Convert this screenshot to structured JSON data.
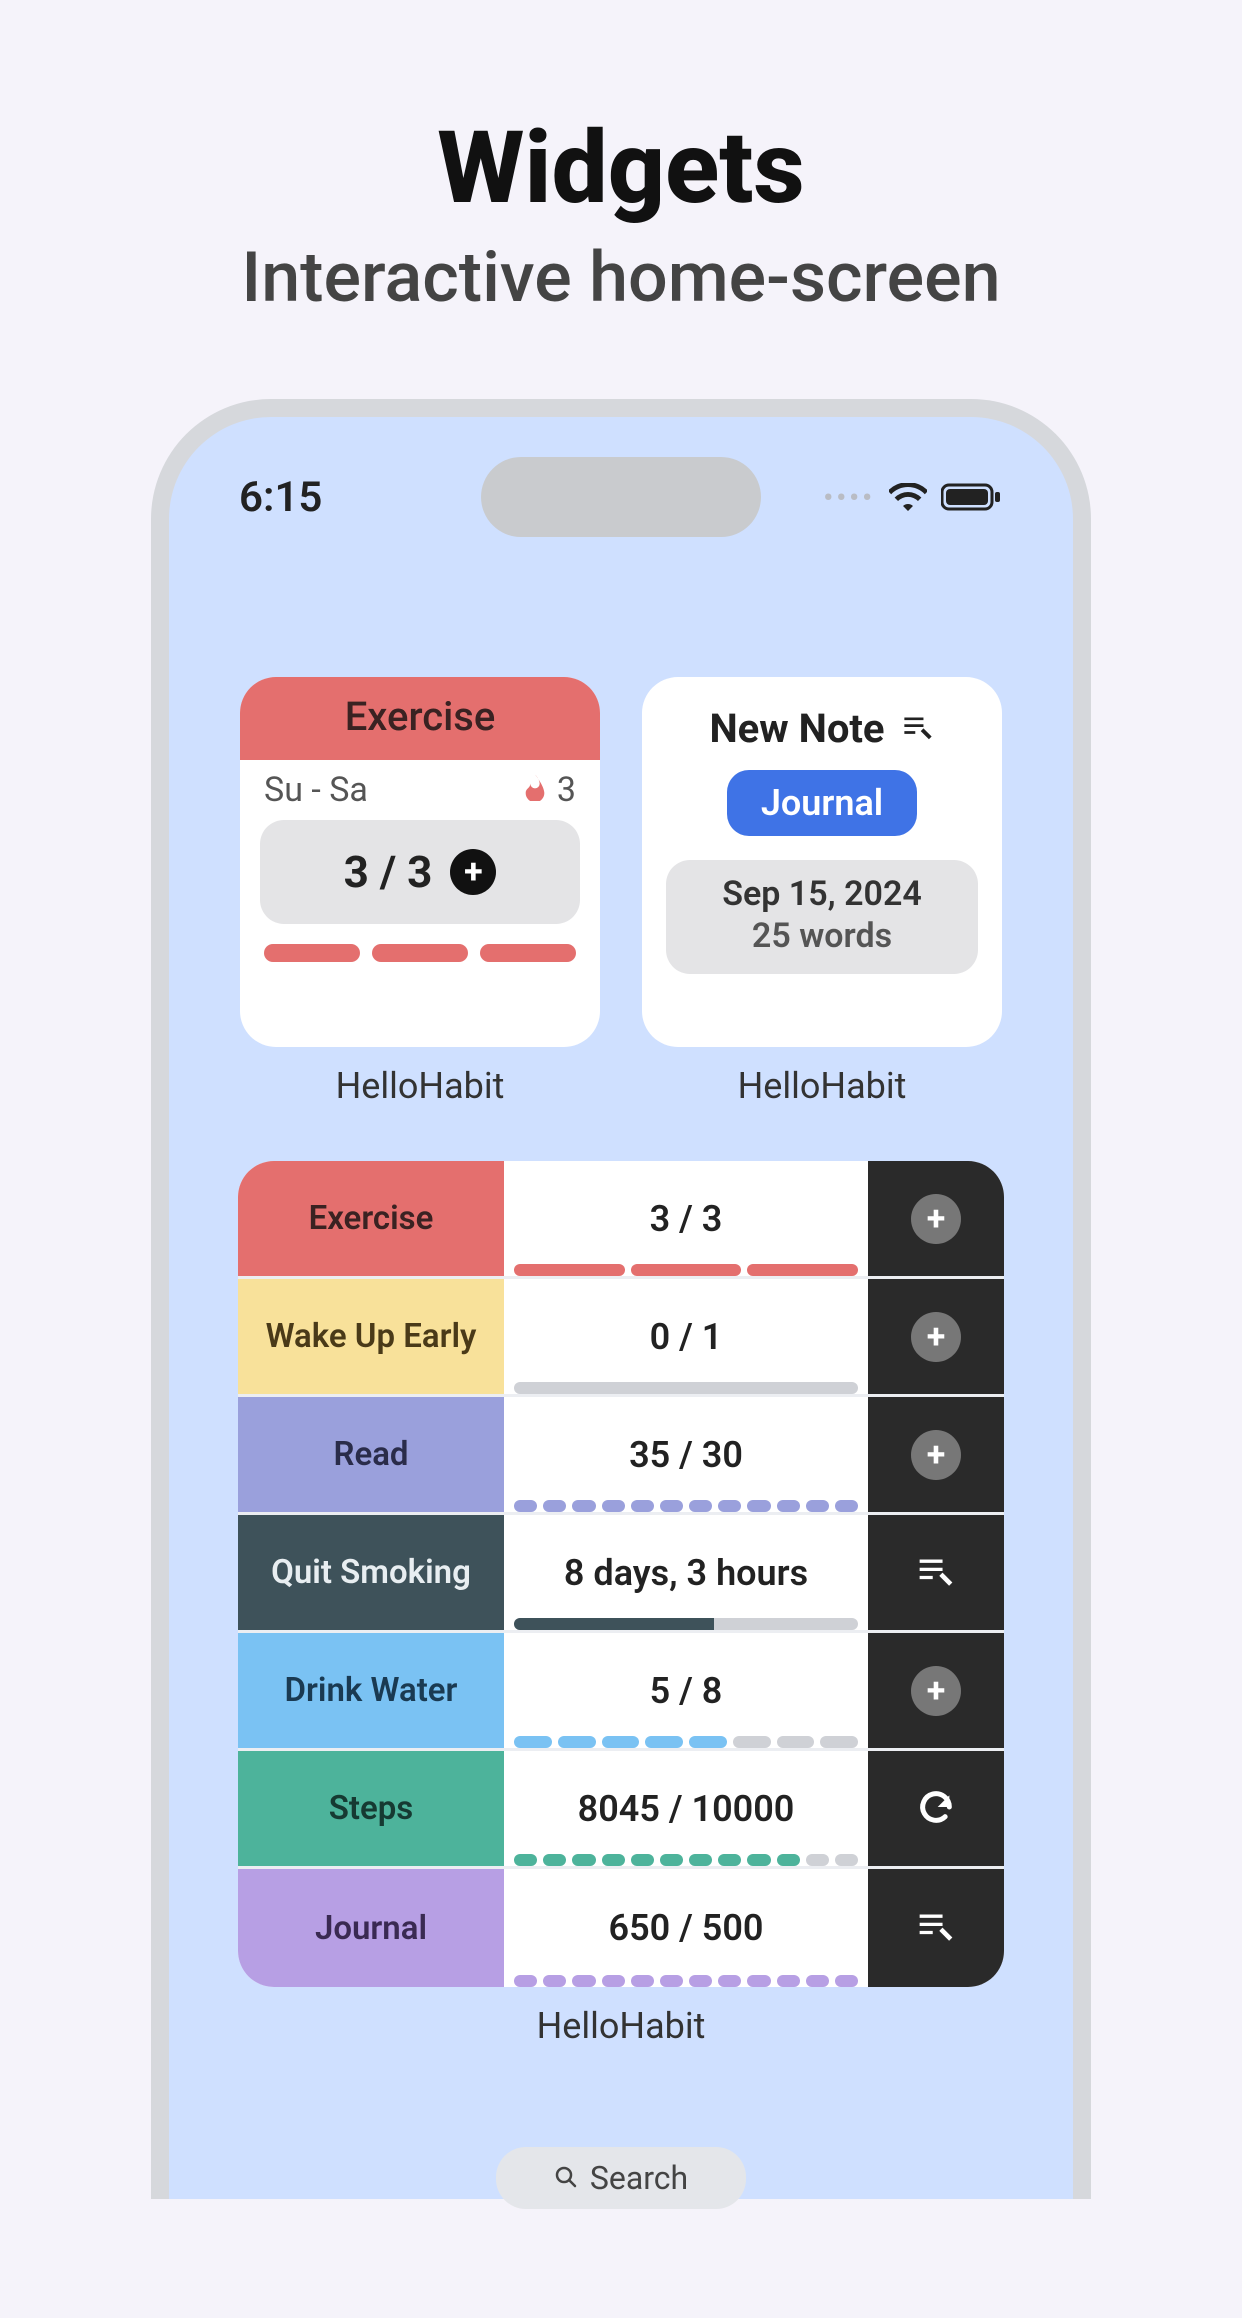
{
  "page": {
    "title": "Widgets",
    "subtitle": "Interactive home-screen"
  },
  "status": {
    "time": "6:15"
  },
  "exercise_widget": {
    "title": "Exercise",
    "range": "Su - Sa",
    "streak": "3",
    "value": "3 / 3",
    "app_label": "HelloHabit"
  },
  "note_widget": {
    "title": "New Note",
    "button": "Journal",
    "date": "Sep 15, 2024",
    "words": "25 words",
    "app_label": "HelloHabit"
  },
  "list_widget": {
    "app_label": "HelloHabit",
    "rows": [
      {
        "name": "Exercise",
        "value": "3 / 3",
        "color": "#e46f6e",
        "action": "plus",
        "segments": 3,
        "filled": 3,
        "type": "segment",
        "text_color": "#3a2222"
      },
      {
        "name": "Wake Up Early",
        "value": "0 / 1",
        "color": "#f8e19a",
        "action": "plus",
        "segments": 1,
        "filled": 0,
        "type": "single",
        "text_color": "#4a3a18"
      },
      {
        "name": "Read",
        "value": "35 / 30",
        "color": "#9aa0dc",
        "action": "plus",
        "segments": 12,
        "filled": 12,
        "type": "segment",
        "text_color": "#2a2c4a"
      },
      {
        "name": "Quit Smoking",
        "value": "8 days, 3 hours",
        "color": "#3e525a",
        "action": "edit",
        "segments": 1,
        "filled": 0,
        "type": "partial",
        "partial": 0.58,
        "text_color": "#e8eef1"
      },
      {
        "name": "Drink Water",
        "value": "5 / 8",
        "color": "#7ac2f3",
        "action": "plus",
        "segments": 8,
        "filled": 5,
        "type": "segment",
        "text_color": "#1a3a52"
      },
      {
        "name": "Steps",
        "value": "8045 / 10000",
        "color": "#4db39b",
        "action": "refresh",
        "segments": 12,
        "filled": 10,
        "type": "segment",
        "text_color": "#163a32"
      },
      {
        "name": "Journal",
        "value": "650 / 500",
        "color": "#b79fe4",
        "action": "edit",
        "segments": 12,
        "filled": 12,
        "type": "segment",
        "text_color": "#3a2a52"
      }
    ]
  },
  "search": {
    "label": "Search"
  }
}
